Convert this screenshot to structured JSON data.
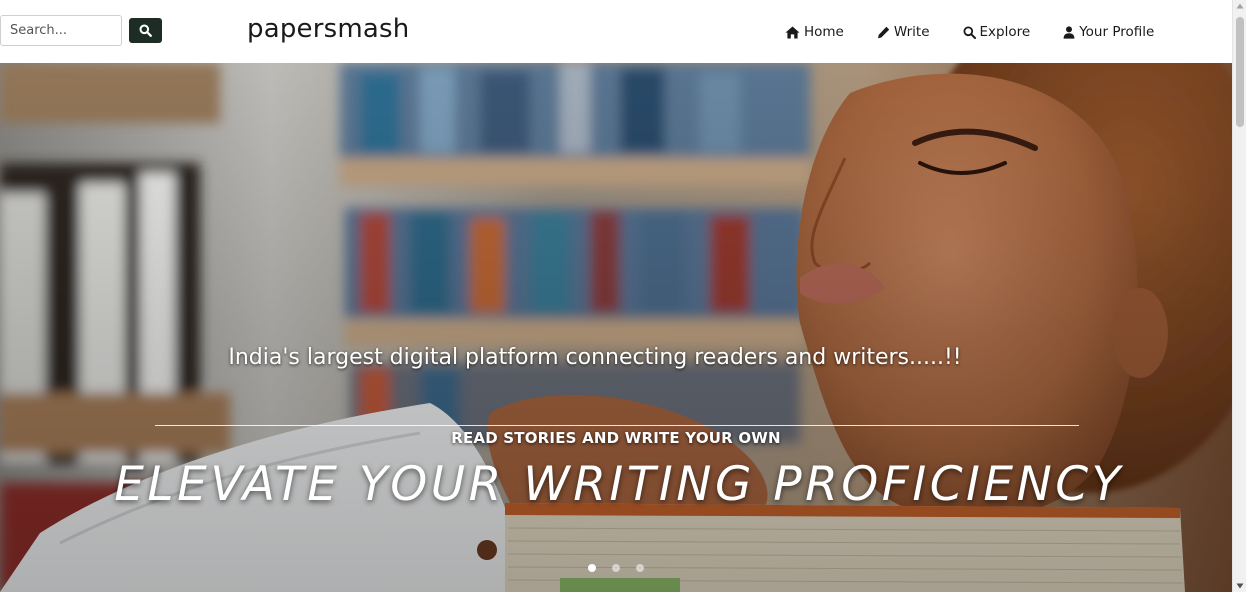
{
  "header": {
    "search": {
      "placeholder": "Search..."
    },
    "brand": "papersmash",
    "nav": [
      {
        "label": "Home",
        "icon": "home-icon"
      },
      {
        "label": "Write",
        "icon": "pencil-icon"
      },
      {
        "label": "Explore",
        "icon": "search-icon"
      },
      {
        "label": "Your Profile",
        "icon": "user-icon"
      }
    ]
  },
  "hero": {
    "tagline": "India's largest digital platform connecting readers and writers.....!!",
    "subhead": "READ STORIES AND WRITE YOUR OWN",
    "headline": "ELEVATE YOUR WRITING PROFICIENCY",
    "slides": {
      "count": 3,
      "active": 0
    }
  },
  "colors": {
    "search_button": "#1d2d26",
    "text_dark": "#1a1a1a",
    "overlay_text": "#ffffff"
  }
}
